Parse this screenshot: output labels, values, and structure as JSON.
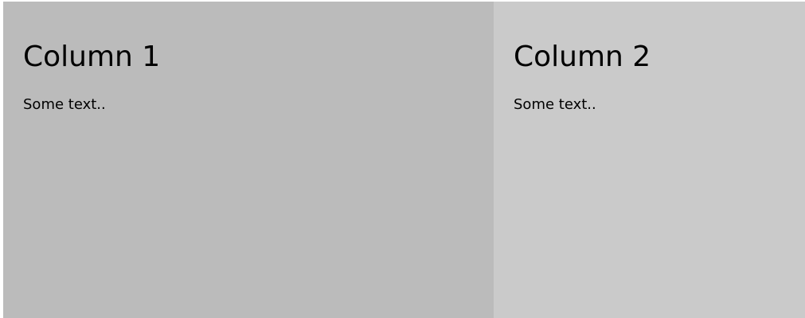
{
  "columns": [
    {
      "title": "Column 1",
      "text": "Some text..",
      "background": "#bbbbbb"
    },
    {
      "title": "Column 2",
      "text": "Some text..",
      "background": "#cacaca"
    }
  ]
}
